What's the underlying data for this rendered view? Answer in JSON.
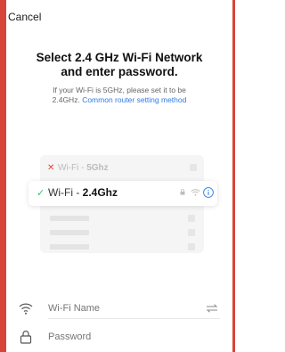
{
  "header": {
    "cancel_label": "Cancel"
  },
  "title_line1": "Select 2.4 GHz Wi-Fi Network",
  "title_line2": "and enter password.",
  "subtitle": {
    "line1": "If your Wi-Fi is 5GHz, please set it to be",
    "line2_prefix": "2.4GHz.",
    "link": "Common router setting method"
  },
  "illustration": {
    "row_5g": {
      "mark": "✕",
      "prefix": "Wi-Fi - ",
      "band": "5Ghz"
    },
    "row_24": {
      "mark": "✓",
      "prefix": "Wi-Fi - ",
      "band": "2.4Ghz"
    },
    "icons": [
      "check-icon",
      "lock-icon",
      "wifi-icon",
      "info-icon"
    ]
  },
  "wifi_name": {
    "placeholder": "Wi-Fi Name",
    "icon": "wifi-icon",
    "action_icon": "swap-icon"
  },
  "password": {
    "placeholder": "Password",
    "icon": "lock-icon"
  },
  "colors": {
    "accent": "#2f7be6",
    "frame": "#d8443a",
    "success": "#3fbf76",
    "error": "#e2453b"
  }
}
